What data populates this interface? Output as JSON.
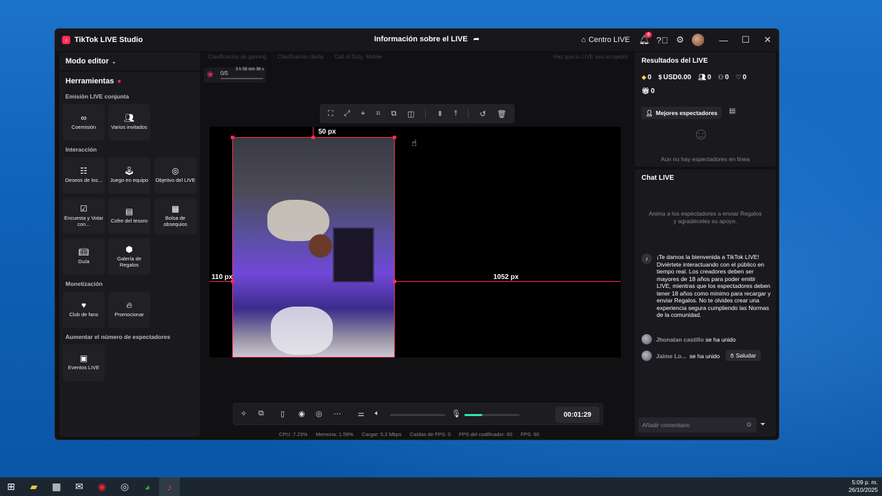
{
  "window": {
    "app_title": "TikTok LIVE Studio",
    "center_title": "Información sobre el LIVE",
    "centro_live": "Centro LIVE",
    "notification_count": "4"
  },
  "left": {
    "modo": "Modo editor",
    "herramientas": "Herramientas",
    "sections": {
      "conjunta": "Emisión LIVE conjunta",
      "interaccion": "Interacción",
      "monetizacion": "Monetización",
      "aumentar": "Aumentar el número de espectadores"
    },
    "tools": {
      "coemision": "Coemisión",
      "varios": "Varios invitados",
      "deseos": "Deseos de los...",
      "juego": "Juego en equipo",
      "objetivo": "Objetivo del LIVE",
      "encuesta": "Encuesta y Votar con...",
      "cofre": "Cofre del tesoro",
      "bolsa": "Bolsa de obsequios",
      "guia": "Guía",
      "galeria": "Galería de Regalos",
      "club": "Club de fans",
      "promocionar": "Promocionar",
      "eventos": "Eventos LIVE"
    }
  },
  "center": {
    "chips": [
      "Clasificación de gaming",
      "Clasificación diaria",
      "Call of Duty: Mobile"
    ],
    "hint": "Haz que tu LIVE sea acogedor",
    "goal_count": "0/5",
    "goal_timer": "3 h 58 min 36 s",
    "guide_top": "50 px",
    "guide_left": "110 px",
    "guide_right": "1052 px",
    "timer": "00:01:29",
    "volume_level": 0.0,
    "mic_level": 0.33,
    "stats": {
      "cpu": "CPU:  7.23%",
      "memoria": "Memoria:  1.59%",
      "cargar": "Cargar:  5.2 Mbps",
      "caidas": "Caídas de FPS:  0",
      "fps_cod": "FPS del codificador:  60",
      "fps": "FPS:  60"
    }
  },
  "right": {
    "results_title": "Resultados del LIVE",
    "diamonds": "0",
    "usd": "USD0.00",
    "viewers": "0",
    "followers": "0",
    "likes": "0",
    "gifts": "0",
    "best_viewers": "Mejores espectadores",
    "no_viewers": "Aún no hay espectadores en línea",
    "chat_title": "Chat LIVE",
    "chat_invite": "Anima a los espectadores a enviar Regalos y agradéceles su apoyo.",
    "welcome": "¡Te damos la bienvenida a TikTok LIVE! Diviértete interactuando con el público en tiempo real. Los creadores deben ser mayores de 18 años para poder emitir LIVE, mientras que los espectadores deben tener 18 años como mínimo para recargar y enviar Regalos. No te olvides crear una experiencia segura cumpliendo las Normas de la comunidad.",
    "join1_user": "Jhonatan castillo",
    "join1_text": "se ha unido",
    "join2_user": "Jaime Lo...",
    "join2_text": "se ha unido",
    "saludar": "Saludar",
    "comment_placeholder": "Añadir comentario"
  },
  "taskbar": {
    "time": "5:09 p. m.",
    "date": "26/10/2025"
  }
}
